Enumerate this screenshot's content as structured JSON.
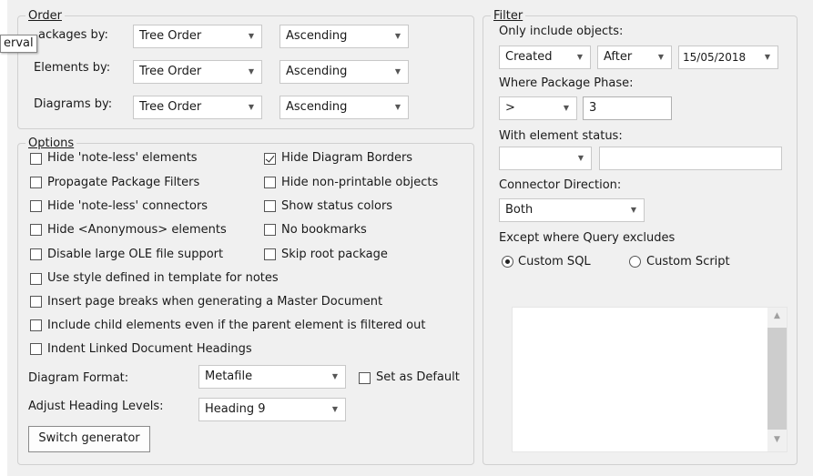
{
  "tooltip": "erval",
  "order": {
    "legend": "Order",
    "packages_label": "ackages by:",
    "elements_label": "Elements by:",
    "diagrams_label": "Diagrams by:",
    "packages_sort": "Tree Order",
    "packages_dir": "Ascending",
    "elements_sort": "Tree Order",
    "elements_dir": "Ascending",
    "diagrams_sort": "Tree Order",
    "diagrams_dir": "Ascending"
  },
  "options": {
    "legend": "Options",
    "left": [
      {
        "label": "Hide 'note-less' elements",
        "checked": false
      },
      {
        "label": "Propagate Package Filters",
        "checked": false
      },
      {
        "label": "Hide 'note-less' connectors",
        "checked": false
      },
      {
        "label": "Hide <Anonymous> elements",
        "checked": false
      },
      {
        "label": "Disable large OLE file support",
        "checked": false
      }
    ],
    "right": [
      {
        "label": "Hide Diagram Borders",
        "checked": true
      },
      {
        "label": "Hide non-printable objects",
        "checked": false
      },
      {
        "label": "Show status colors",
        "checked": false
      },
      {
        "label": "No bookmarks",
        "checked": false
      },
      {
        "label": "Skip root package",
        "checked": false
      }
    ],
    "full": [
      {
        "label": "Use style defined in template for notes",
        "checked": false
      },
      {
        "label": "Insert page breaks when generating a Master Document",
        "checked": false
      },
      {
        "label": "Include child elements even if the parent element is filtered out",
        "checked": false
      },
      {
        "label": "Indent Linked Document Headings",
        "checked": false
      }
    ],
    "diagram_format_label": "Diagram Format:",
    "diagram_format_value": "Metafile",
    "set_default_label": "Set as Default",
    "heading_label": "Adjust Heading Levels:",
    "heading_value": "Heading 9",
    "switch_button": "Switch generator"
  },
  "filter": {
    "legend": "Filter",
    "only_include_label": "Only include objects:",
    "created_value": "Created",
    "after_value": "After",
    "date_value": "15/05/2018",
    "phase_label": "Where Package Phase:",
    "phase_op": ">",
    "phase_value": "3",
    "status_label": "With element status:",
    "status_value": "",
    "status_text": "",
    "connector_label": "Connector Direction:",
    "connector_value": "Both",
    "except_label": "Except where Query excludes",
    "radio_sql": "Custom SQL",
    "radio_script": "Custom Script",
    "radio_selected": "Custom SQL"
  },
  "icons": {
    "dropdown": "chevron-down-icon",
    "scroll_up": "scroll-up-arrow-icon",
    "scroll_down": "scroll-down-arrow-icon"
  },
  "colors": {
    "panel_bg": "#f0f0f0",
    "border": "#d0d0d0"
  }
}
